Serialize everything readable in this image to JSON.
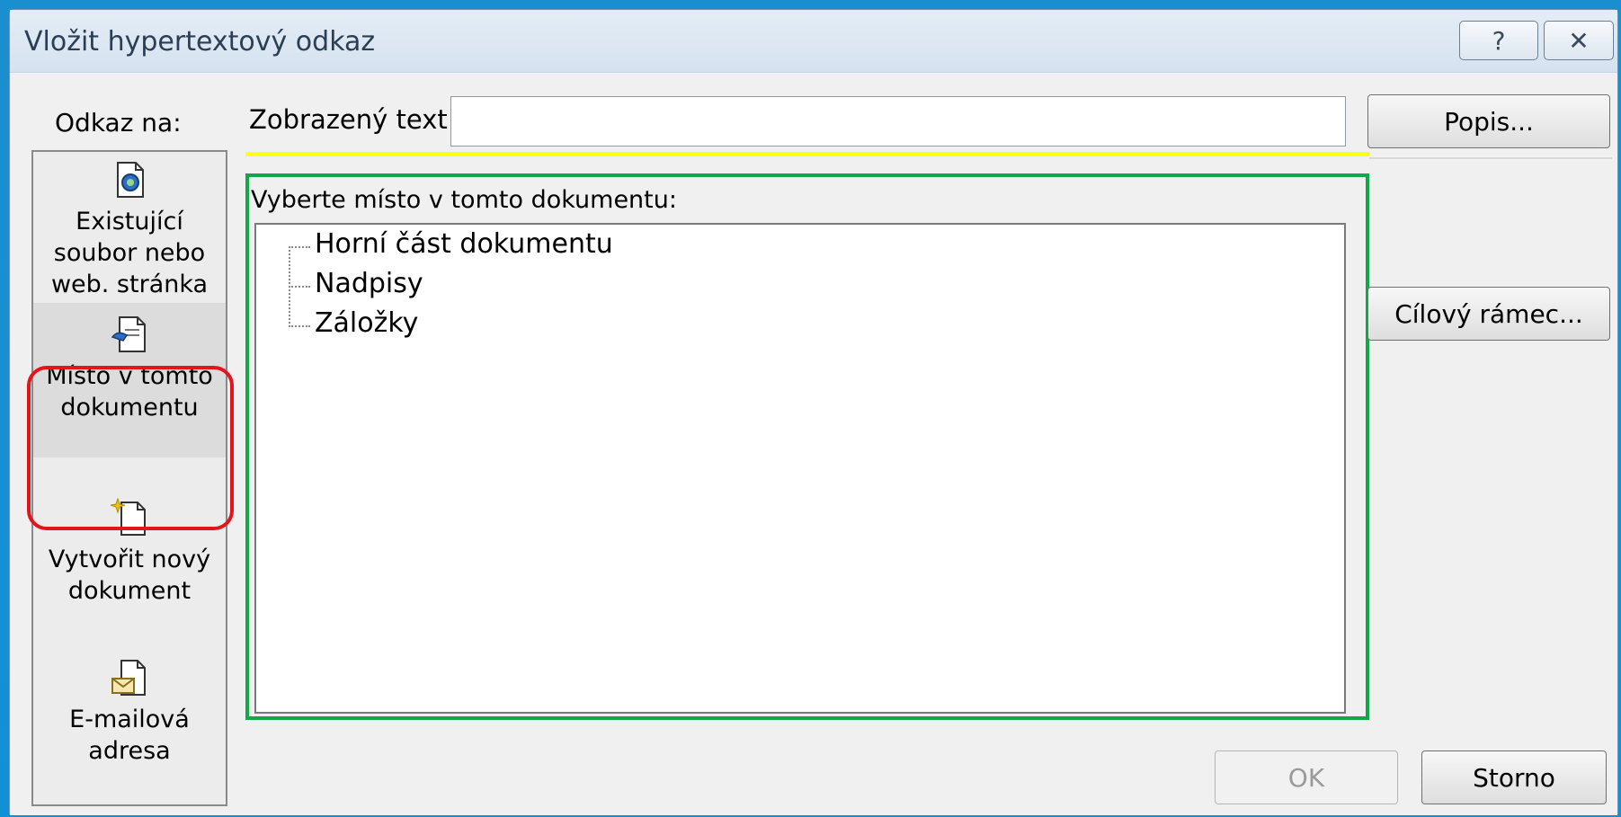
{
  "dialog": {
    "title": "Vložit hypertextový odkaz",
    "help_label": "?",
    "close_label": "✕"
  },
  "link_to": {
    "label": "Odkaz na:",
    "items": [
      {
        "label_line1": "Existující",
        "label_line2": "soubor nebo",
        "label_line3": "web. stránka",
        "icon": "existing-file-icon"
      },
      {
        "label_line1": "Místo v tomto",
        "label_line2": "dokumentu",
        "icon": "place-in-document-icon",
        "selected": true
      },
      {
        "label_line1": "Vytvořit nový",
        "label_line2": "dokument",
        "icon": "new-document-icon"
      },
      {
        "label_line1": "E-mailová",
        "label_line2": "adresa",
        "icon": "email-address-icon"
      }
    ]
  },
  "display_text": {
    "label": "Zobrazený text:",
    "value": ""
  },
  "buttons": {
    "popis": "Popis...",
    "cilovy_ramec": "Cílový rámec...",
    "ok": "OK",
    "storno": "Storno"
  },
  "place_select": {
    "label": "Vyberte místo v tomto dokumentu:",
    "tree": [
      "Horní část dokumentu",
      "Nadpisy",
      "Záložky"
    ]
  },
  "colors": {
    "highlight_selected": "#e3141c",
    "highlight_tree": "#12a84a",
    "highlight_text": "#ffff1a"
  }
}
